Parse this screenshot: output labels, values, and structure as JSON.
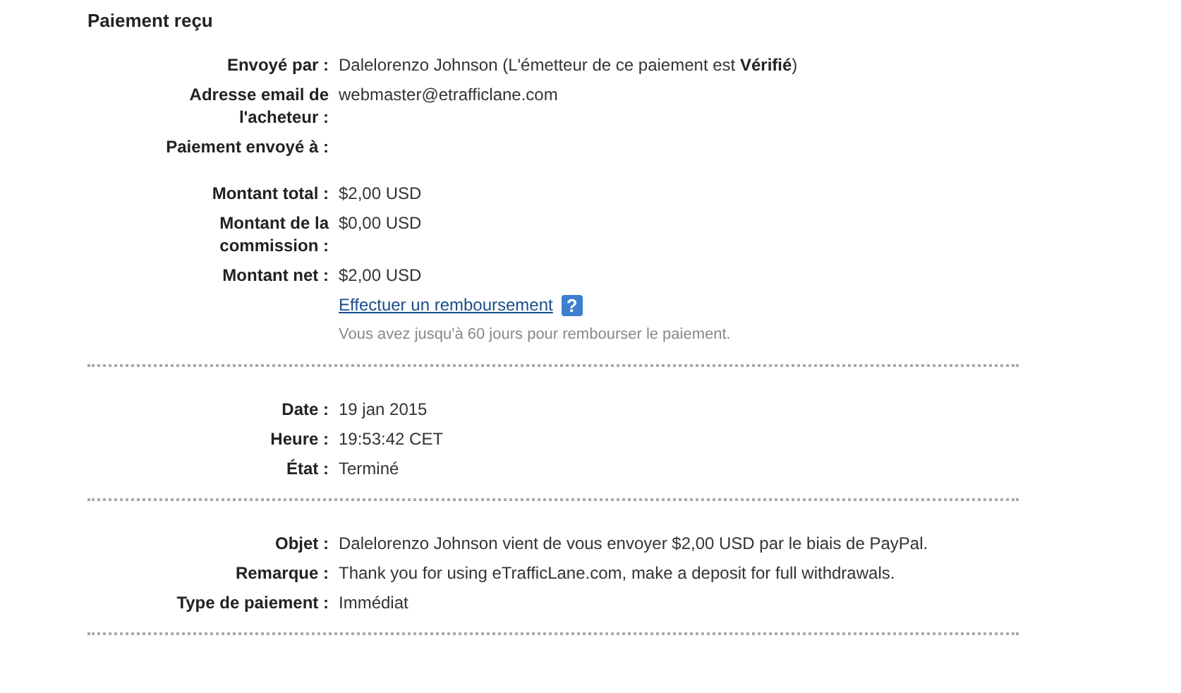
{
  "title": "Paiement reçu",
  "sections": [
    {
      "groups": [
        [
          {
            "kind": "field",
            "label": "Envoyé par :",
            "value": "Dalelorenzo Johnson (L'émetteur de ce paiement est **Vérifié**)"
          },
          {
            "kind": "field",
            "label": "Adresse email de l'acheteur :",
            "value": "webmaster@etrafficlane.com"
          },
          {
            "kind": "field",
            "label": "Paiement envoyé à :"
          }
        ],
        [
          {
            "kind": "field",
            "label": "Montant total :",
            "value": "$2,00 USD"
          },
          {
            "kind": "field",
            "label": "Montant de la commission :",
            "value": "$0,00 USD"
          },
          {
            "kind": "field",
            "label": "Montant net :",
            "value": "$2,00 USD"
          },
          {
            "kind": "link",
            "value": "Effectuer un remboursement",
            "help": "?"
          },
          {
            "kind": "note",
            "value": "Vous avez jusqu'à 60 jours pour rembourser le paiement."
          }
        ]
      ]
    },
    {
      "groups": [
        [
          {
            "kind": "field",
            "label": "Date :",
            "value": "19 jan 2015"
          },
          {
            "kind": "field",
            "label": "Heure :",
            "value": "19:53:42 CET"
          },
          {
            "kind": "field",
            "label": "État :",
            "value": "Terminé"
          }
        ]
      ]
    },
    {
      "groups": [
        [
          {
            "kind": "field",
            "label": "Objet :",
            "value": "Dalelorenzo Johnson vient de vous envoyer $2,00 USD par le biais de PayPal."
          },
          {
            "kind": "field",
            "label": "Remarque :",
            "value": "Thank you for using eTrafficLane.com, make a deposit for full withdrawals."
          },
          {
            "kind": "field",
            "label": "Type de paiement :",
            "value": "Immédiat"
          }
        ]
      ]
    }
  ]
}
